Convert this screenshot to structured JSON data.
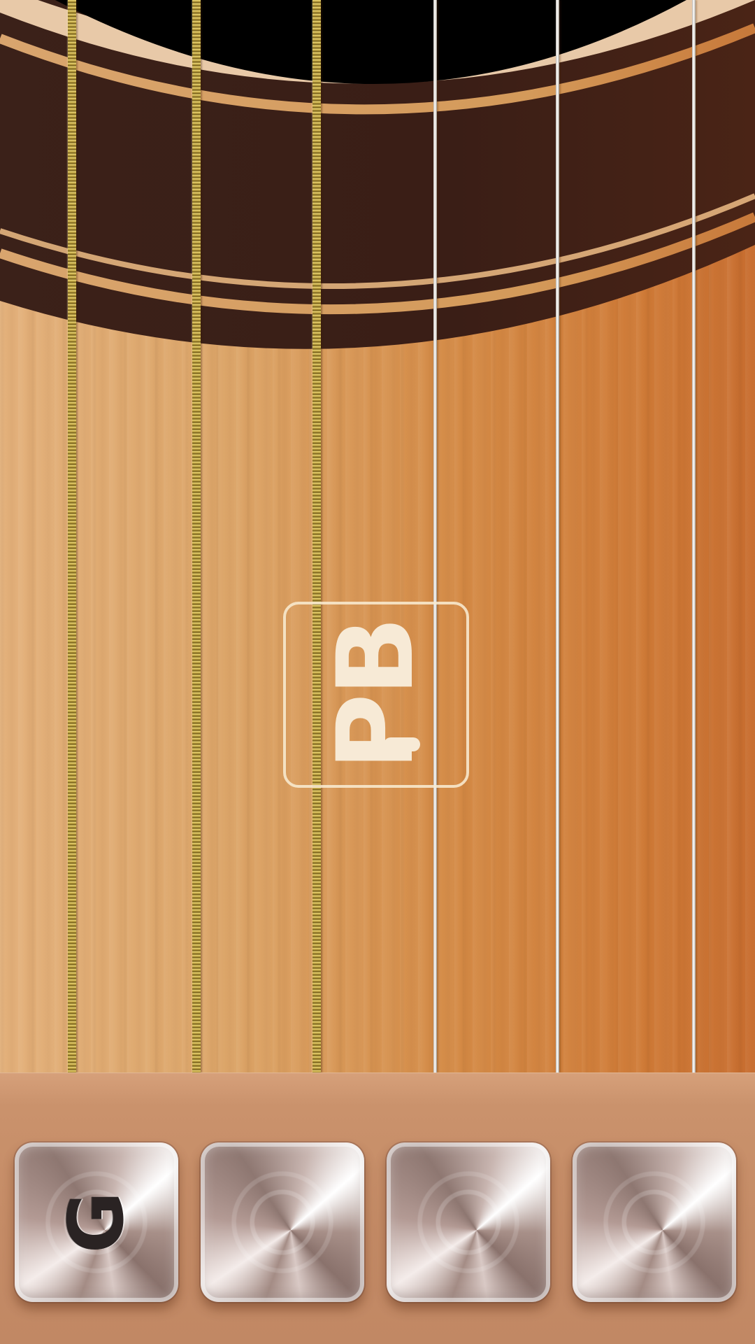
{
  "app": {
    "logo_text": "PB",
    "orientation": "rotated-landscape"
  },
  "strings": [
    {
      "name": "string-1",
      "type": "wound"
    },
    {
      "name": "string-2",
      "type": "wound"
    },
    {
      "name": "string-3",
      "type": "wound"
    },
    {
      "name": "string-4",
      "type": "plain"
    },
    {
      "name": "string-5",
      "type": "plain"
    },
    {
      "name": "string-6",
      "type": "plain"
    }
  ],
  "chord_keys": [
    {
      "label": "G"
    },
    {
      "label": ""
    },
    {
      "label": ""
    },
    {
      "label": ""
    }
  ],
  "colors": {
    "wood_light": "#e3b07a",
    "wood_dark": "#c86d2f",
    "rosette_dark": "#3a1f17",
    "rosette_light": "#d9a06a",
    "sound_hole": "#000000",
    "logo": "#f7ead6",
    "wound_string": "#bda13f",
    "plain_string": "#f2f0ec",
    "key_metal": "#c8b5b0"
  },
  "icons": {
    "sound_hole": "sound-hole-circle",
    "rosette": "rosette-rings"
  }
}
